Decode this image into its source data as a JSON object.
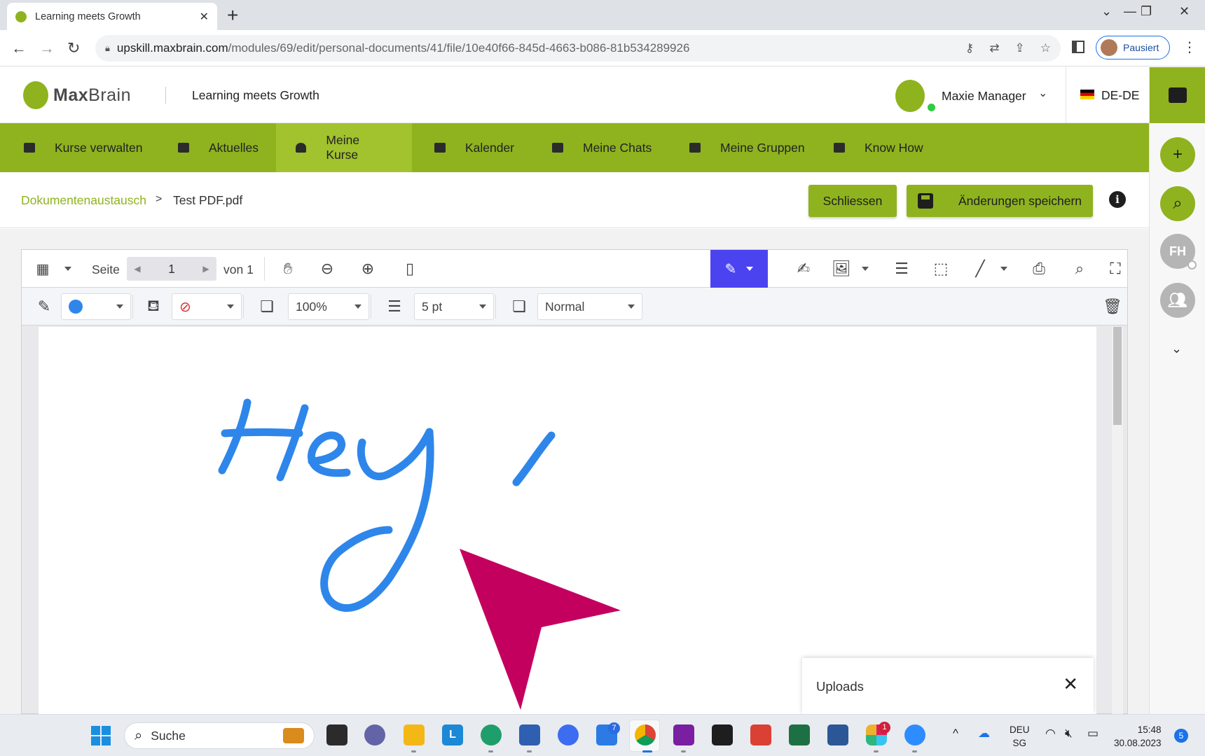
{
  "browser": {
    "tab_title": "Learning meets Growth",
    "tab_close": "✕",
    "new_tab": "+",
    "url_host": "upskill.maxbrain.com",
    "url_path": "/modules/69/edit/personal-documents/41/file/10e40f66-845d-4663-b086-81b534289926",
    "profile_label": "Pausiert"
  },
  "header": {
    "logo_bold": "Max",
    "logo_rest": "Brain",
    "slogan": "Learning meets Growth",
    "user_name": "Maxie Manager",
    "language": "DE-DE"
  },
  "nav": {
    "items": [
      {
        "label": "Kurse verwalten"
      },
      {
        "label": "Aktuelles"
      },
      {
        "label": "Meine Kurse"
      },
      {
        "label": "Kalender"
      },
      {
        "label": "Meine Chats"
      },
      {
        "label": "Meine Gruppen"
      },
      {
        "label": "Know How"
      }
    ],
    "active": "Meine Kurse"
  },
  "breadcrumb": {
    "parent": "Dokumentenaustausch",
    "separator": ">",
    "current": "Test PDF.pdf"
  },
  "actions": {
    "close_label": "Schliessen",
    "save_label": "Änderungen speichern",
    "info_label": "i"
  },
  "viewer": {
    "page_label": "Seite",
    "page_current": "1",
    "page_total_label": "von 1",
    "stroke_color": "#2e86ea",
    "opacity": "100%",
    "thickness": "5 pt",
    "blend_mode": "Normal",
    "drawing_text": "Hey!"
  },
  "right_rail": {
    "avatar_initials": "FH"
  },
  "uploads": {
    "label": "Uploads",
    "close": "✕"
  },
  "taskbar": {
    "search_label": "Suche",
    "todo_badge": "7",
    "slack_badge": "1",
    "lang_top": "DEU",
    "lang_bottom": "SG",
    "time": "15:48",
    "date": "30.08.2023",
    "notifications": "5"
  },
  "colors": {
    "brand_green": "#8fb31f",
    "active_tool": "#4c43f0",
    "ink_blue": "#2e86ea",
    "cursor_magenta": "#c4005f"
  }
}
